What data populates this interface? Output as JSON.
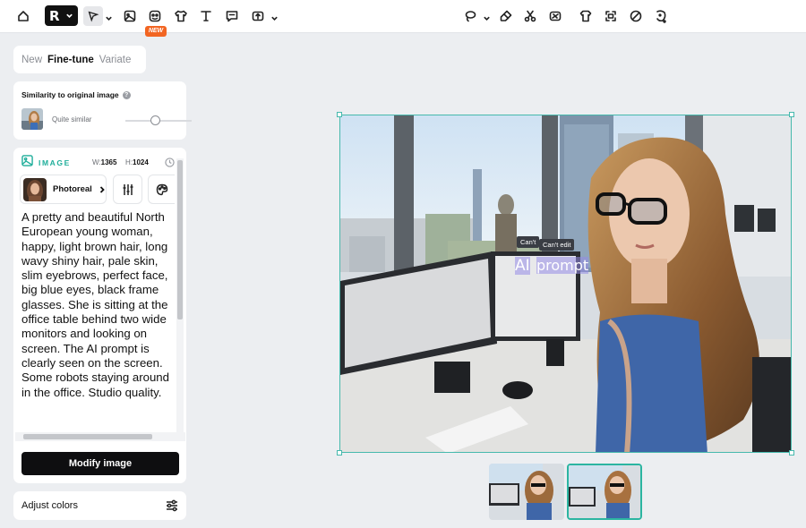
{
  "toolbar": {
    "new_badge": "NEW",
    "logo_letter": "R"
  },
  "mode_tabs": [
    {
      "label": "New",
      "active": false
    },
    {
      "label": "Fine-tune",
      "active": true
    },
    {
      "label": "Variate",
      "active": false
    }
  ],
  "similarity": {
    "title": "Similarity to original image",
    "help": "?",
    "value_label": "Quite similar",
    "level": 0.45
  },
  "image_card": {
    "label": "IMAGE",
    "width_label": "W:",
    "width_value": "1365",
    "height_label": "H:",
    "height_value": "1024",
    "style_label": "Photoreal",
    "prompt": "A pretty and beautiful North European young woman, happy, light brown hair, long wavy shiny hair, pale skin, slim eyebrows, perfect face, big blue eyes, black frame glasses. She is sitting at the office table behind two wide monitors and looking on screen. The AI prompt is clearly seen on the screen. Some robots staying around in the office. Studio quality.",
    "modify_button": "Modify image"
  },
  "adjust_colors": {
    "label": "Adjust colors"
  },
  "canvas": {
    "tooltip_cant": "Can't",
    "tooltip_edit": "Can't edit",
    "screen_text_ai": "AI",
    "screen_text_prompt": "prompt"
  },
  "colors": {
    "accent": "#1fae9a",
    "selection": "#46b9ad",
    "badge": "#f26522",
    "button": "#0e0e10"
  }
}
